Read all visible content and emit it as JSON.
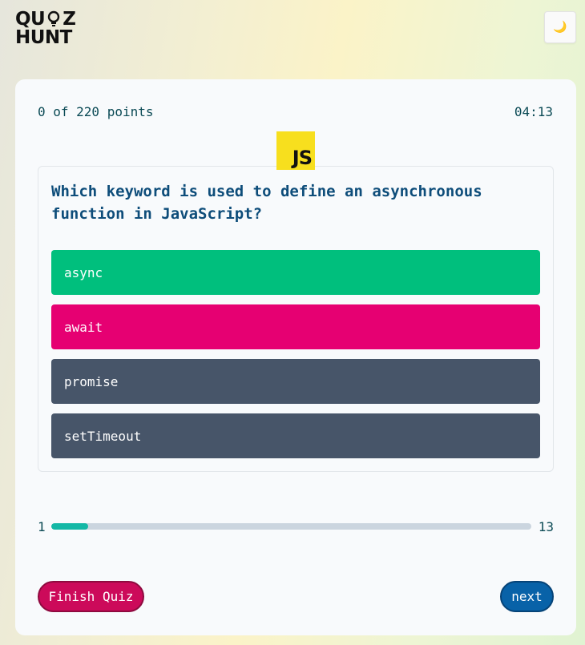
{
  "brand": {
    "line1_a": "QU",
    "line1_b": "Z",
    "line2": "HUNT"
  },
  "theme_toggle": {
    "icon": "moon-icon",
    "glyph": "🌙"
  },
  "quiz": {
    "points_text": "0 of 220 points",
    "timer": "04:13",
    "language_badge": "JS",
    "question": "Which keyword is used to define an asynchronous function in JavaScript?",
    "answers": [
      {
        "label": "async",
        "state": "correct",
        "color": "#00bf7d"
      },
      {
        "label": "await",
        "state": "wrong",
        "color": "#e60072"
      },
      {
        "label": "promise",
        "state": "neutral",
        "color": "#475569"
      },
      {
        "label": "setTimeout",
        "state": "neutral",
        "color": "#475569"
      }
    ]
  },
  "progress": {
    "current": "1",
    "total": "13",
    "fraction": 0.077,
    "color": "#14b8a6"
  },
  "actions": {
    "finish_label": "Finish Quiz",
    "next_label": "next"
  }
}
